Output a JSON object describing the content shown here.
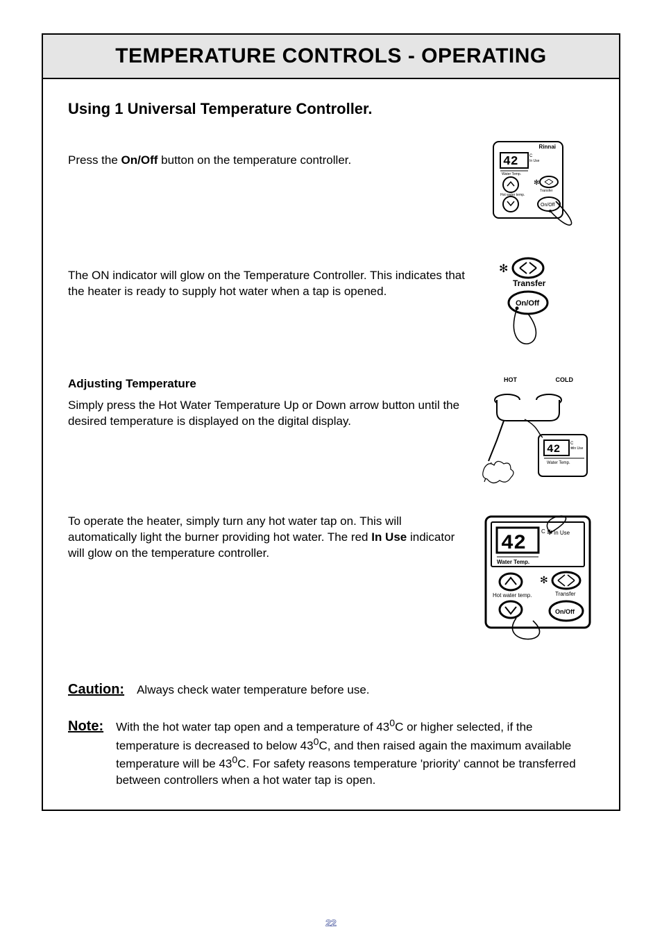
{
  "page_number": "22",
  "title": "TEMPERATURE CONTROLS - OPERATING",
  "subtitle": "Using 1 Universal Temperature Controller.",
  "step1_part_a": "Press the ",
  "step1_bold": "On/Off",
  "step1_part_b": " button on the temperature controller.",
  "step2": "The ON indicator will glow on the Temperature Controller. This indicates that the heater is ready to supply hot water when a tap is opened.",
  "adjust_heading": "Adjusting Temperature",
  "step3": "Simply press the Hot Water Temperature Up or Down arrow button until the desired temperature is displayed on the digital display.",
  "step4_a": "To operate the heater, simply turn any hot water tap on. This will automatically light the burner providing hot water. The red ",
  "step4_bold": "In Use",
  "step4_b": " indicator will glow on the temperature controller.",
  "caution_label": "Caution:",
  "caution_text": "Always check water temperature before use.",
  "note_label": "Note:",
  "note_text_a": "With the hot water tap open and a temperature of 43",
  "note_text_b": "C or higher selected, if the temperature is decreased to below 43",
  "note_text_c": "C, and then raised again the maximum available temperature will be 43",
  "note_text_d": "C.  For safety reasons temperature 'priority' cannot be transferred between controllers when a hot water tap is open.",
  "diagram": {
    "brand": "Rinnai",
    "temp_value": "42",
    "c_unit": "C",
    "in_use": "In Use",
    "water_temp": "Water Temp.",
    "transfer": "Transfer",
    "onoff": "On/Off",
    "hot_water_temp": "Hot water temp.",
    "hot": "HOT",
    "cold": "COLD"
  }
}
